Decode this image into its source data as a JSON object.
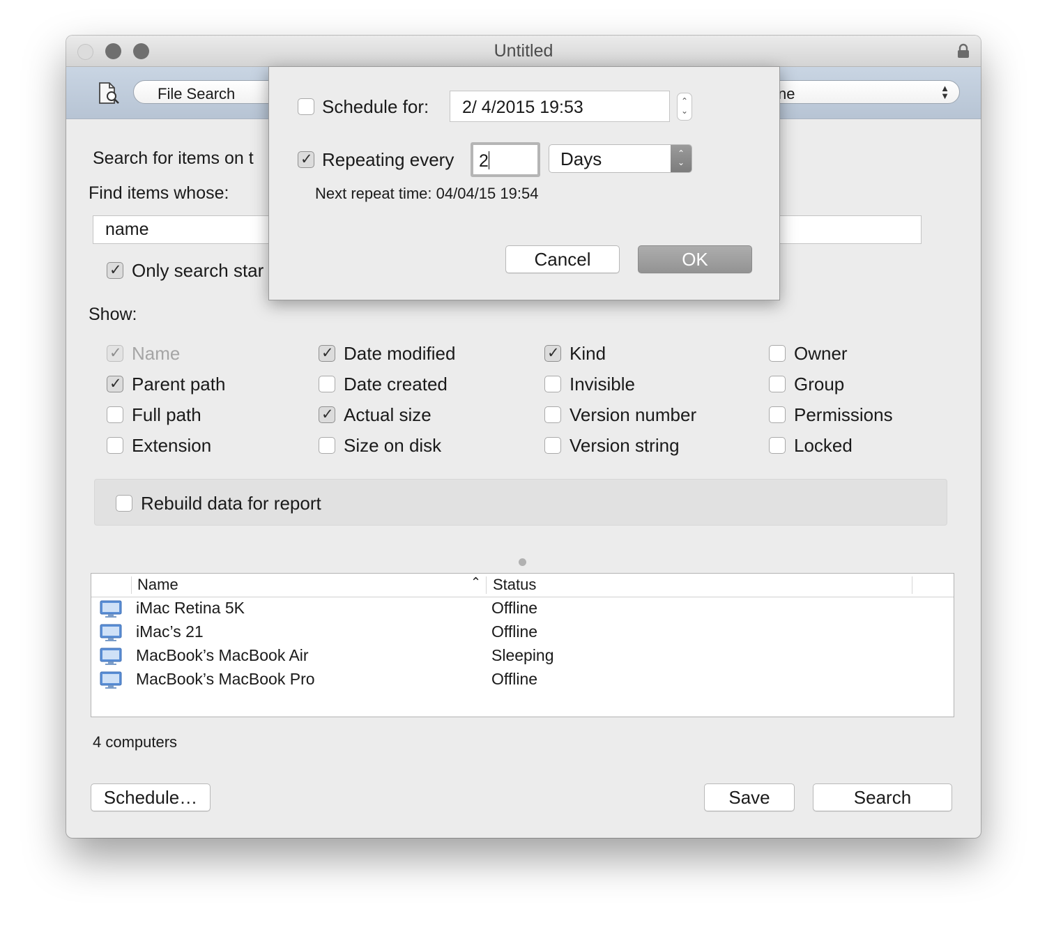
{
  "window": {
    "title": "Untitled"
  },
  "toolbar": {
    "segment_label": "File Search",
    "popup_value": "ne"
  },
  "main": {
    "search_on_label": "Search for items on t",
    "find_label": "Find items whose:",
    "criteria_value": "name",
    "only_search_label": "Only search star",
    "show_label": "Show:"
  },
  "show_options": {
    "name": "Name",
    "date_modified": "Date modified",
    "kind": "Kind",
    "owner": "Owner",
    "parent_path": "Parent path",
    "date_created": "Date created",
    "invisible": "Invisible",
    "group": "Group",
    "full_path": "Full path",
    "actual_size": "Actual size",
    "version_number": "Version number",
    "permissions": "Permissions",
    "extension": "Extension",
    "size_on_disk": "Size on disk",
    "version_string": "Version string",
    "locked": "Locked"
  },
  "rebuild_label": "Rebuild data for report",
  "table": {
    "columns": [
      "Name",
      "Status"
    ],
    "rows": [
      {
        "name": "iMac Retina 5K",
        "status": "Offline"
      },
      {
        "name": "iMac’s 21",
        "status": "Offline"
      },
      {
        "name": "MacBook’s MacBook Air",
        "status": "Sleeping"
      },
      {
        "name": "MacBook’s MacBook Pro",
        "status": "Offline"
      }
    ]
  },
  "count_label": "4 computers",
  "buttons": {
    "schedule": "Schedule…",
    "save": "Save",
    "search": "Search"
  },
  "sheet": {
    "schedule_label": "Schedule for:",
    "schedule_value": "2/  4/2015 19:53",
    "repeat_label": "Repeating every",
    "repeat_value": "2",
    "unit_value": "Days",
    "next_repeat": "Next repeat time: 04/04/15 19:54",
    "cancel": "Cancel",
    "ok": "OK"
  }
}
